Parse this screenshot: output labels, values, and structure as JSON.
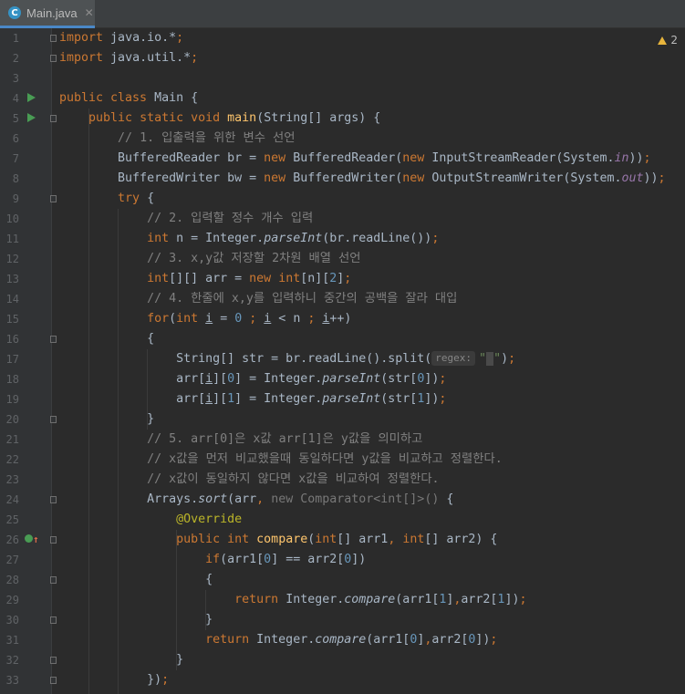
{
  "tab": {
    "label": "Main.java",
    "icon": "java-class-icon"
  },
  "warnings": {
    "count": "2"
  },
  "lines": [
    {
      "n": "1",
      "html": "<span class=\"kw\">import</span> java.io.*<span class=\"kw\">;</span>"
    },
    {
      "n": "2",
      "html": "<span class=\"kw\">import</span> java.util.*<span class=\"kw\">;</span>"
    },
    {
      "n": "3",
      "html": ""
    },
    {
      "n": "4",
      "html": "<span class=\"kw\">public class</span> Main {"
    },
    {
      "n": "5",
      "html": "    <span class=\"kw\">public static void</span> <span class=\"fn\">main</span>(String[] args) {"
    },
    {
      "n": "6",
      "html": "        <span class=\"cm\">// 1. 입출력을 위한 변수 선언</span>"
    },
    {
      "n": "7",
      "html": "        BufferedReader br = <span class=\"kw\">new</span> BufferedReader(<span class=\"kw\">new</span> InputStreamReader(System.<span class=\"st\">in</span>))<span class=\"kw\">;</span>"
    },
    {
      "n": "8",
      "html": "        BufferedWriter bw = <span class=\"kw\">new</span> BufferedWriter(<span class=\"kw\">new</span> OutputStreamWriter(System.<span class=\"st\">out</span>))<span class=\"kw\">;</span>"
    },
    {
      "n": "9",
      "html": "        <span class=\"kw\">try</span> {"
    },
    {
      "n": "10",
      "html": "            <span class=\"cm\">// 2. 입력할 정수 개수 입력</span>"
    },
    {
      "n": "11",
      "html": "            <span class=\"kw\">int</span> n = Integer.<span class=\"it\">parseInt</span>(br.readLine())<span class=\"kw\">;</span>"
    },
    {
      "n": "12",
      "html": "            <span class=\"cm\">// 3. x,y값 저장할 2차원 배열 선언</span>"
    },
    {
      "n": "13",
      "html": "            <span class=\"kw\">int</span>[][] arr = <span class=\"kw\">new int</span>[n][<span class=\"num\">2</span>]<span class=\"kw\">;</span>"
    },
    {
      "n": "14",
      "html": "            <span class=\"cm\">// 4. 한줄에 x,y를 입력하니 중간의 공백을 잘라 대입</span>"
    },
    {
      "n": "15",
      "html": "            <span class=\"kw\">for</span>(<span class=\"kw\">int</span> <span class=\"ul\">i</span> = <span class=\"num\">0</span> <span class=\"kw\">;</span> <span class=\"ul\">i</span> &lt; n <span class=\"kw\">;</span> <span class=\"ul\">i</span>++)"
    },
    {
      "n": "16",
      "html": "            {"
    },
    {
      "n": "17",
      "html": "                String[] str = br.readLine().split(<span class=\"param-hint\">regex:</span><span class=\"str\">\"<span class=\"caret-box\"> </span>\"</span>)<span class=\"kw\">;</span>"
    },
    {
      "n": "18",
      "html": "                arr[<span class=\"ul\">i</span>][<span class=\"num\">0</span>] = Integer.<span class=\"it\">parseInt</span>(str[<span class=\"num\">0</span>])<span class=\"kw\">;</span>"
    },
    {
      "n": "19",
      "html": "                arr[<span class=\"ul\">i</span>][<span class=\"num\">1</span>] = Integer.<span class=\"it\">parseInt</span>(str[<span class=\"num\">1</span>])<span class=\"kw\">;</span>"
    },
    {
      "n": "20",
      "html": "            }"
    },
    {
      "n": "21",
      "html": "            <span class=\"cm\">// 5. arr[0]은 x값 arr[1]은 y값을 의미하고</span>"
    },
    {
      "n": "22",
      "html": "            <span class=\"cm\">// x값을 먼저 비교했을때 동일하다면 y값을 비교하고 정렬한다.</span>"
    },
    {
      "n": "23",
      "html": "            <span class=\"cm\">// x값이 동일하지 않다면 x값을 비교하여 정렬한다.</span>"
    },
    {
      "n": "24",
      "html": "            Arrays.<span class=\"it\">sort</span>(arr<span class=\"kw\">,</span> <span class=\"hint\">new Comparator&lt;int[]&gt;()</span> {"
    },
    {
      "n": "25",
      "html": "                <span class=\"ann\">@Override</span>"
    },
    {
      "n": "26",
      "html": "                <span class=\"kw\">public int</span> <span class=\"fn\">compare</span>(<span class=\"kw\">int</span>[] arr1<span class=\"kw\">,</span> <span class=\"kw\">int</span>[] arr2) {"
    },
    {
      "n": "27",
      "html": "                    <span class=\"kw\">if</span>(arr1[<span class=\"num\">0</span>] == arr2[<span class=\"num\">0</span>])"
    },
    {
      "n": "28",
      "html": "                    {"
    },
    {
      "n": "29",
      "html": "                        <span class=\"kw\">return</span> Integer.<span class=\"it\">compare</span>(arr1[<span class=\"num\">1</span>]<span class=\"kw\">,</span>arr2[<span class=\"num\">1</span>])<span class=\"kw\">;</span>"
    },
    {
      "n": "30",
      "html": "                    }"
    },
    {
      "n": "31",
      "html": "                    <span class=\"kw\">return</span> Integer.<span class=\"it\">compare</span>(arr1[<span class=\"num\">0</span>]<span class=\"kw\">,</span>arr2[<span class=\"num\">0</span>])<span class=\"kw\">;</span>"
    },
    {
      "n": "32",
      "html": "                }"
    },
    {
      "n": "33",
      "html": "            })<span class=\"kw\">;</span>"
    }
  ],
  "markers": {
    "run_lines": [
      "4",
      "5"
    ],
    "override_line": "26",
    "fold_lines": [
      "1",
      "2",
      "5",
      "9",
      "16",
      "20",
      "24",
      "26",
      "28",
      "30",
      "32",
      "33"
    ]
  }
}
